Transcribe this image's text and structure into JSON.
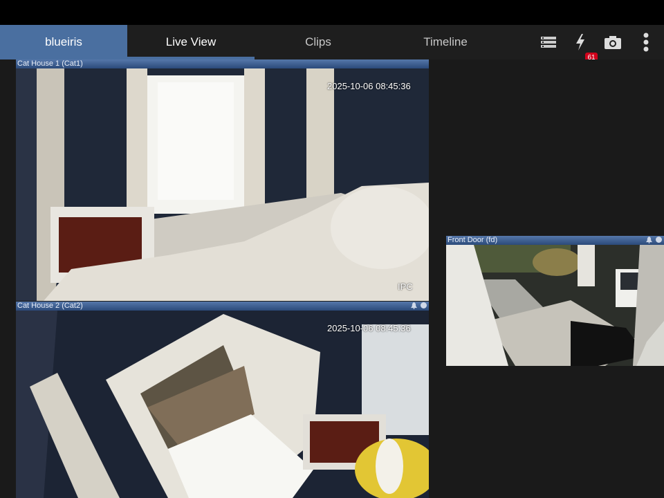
{
  "nav": {
    "brand": "blueiris",
    "tabs": [
      {
        "label": "Live View"
      },
      {
        "label": "Clips"
      },
      {
        "label": "Timeline"
      }
    ],
    "alert_count": "61"
  },
  "cameras": [
    {
      "title": "Cat House 1 (Cat1)",
      "timestamp": "2025-10-06 08:45:36",
      "tag": "IPC"
    },
    {
      "title": "Cat House 2 (Cat2)",
      "timestamp": "2025-10-06 08:45:36"
    },
    {
      "title": "Front Door (fd)"
    }
  ],
  "colors": {
    "accent": "#4a6fa0",
    "badge": "#d0021b",
    "background": "#1a1a1a"
  }
}
